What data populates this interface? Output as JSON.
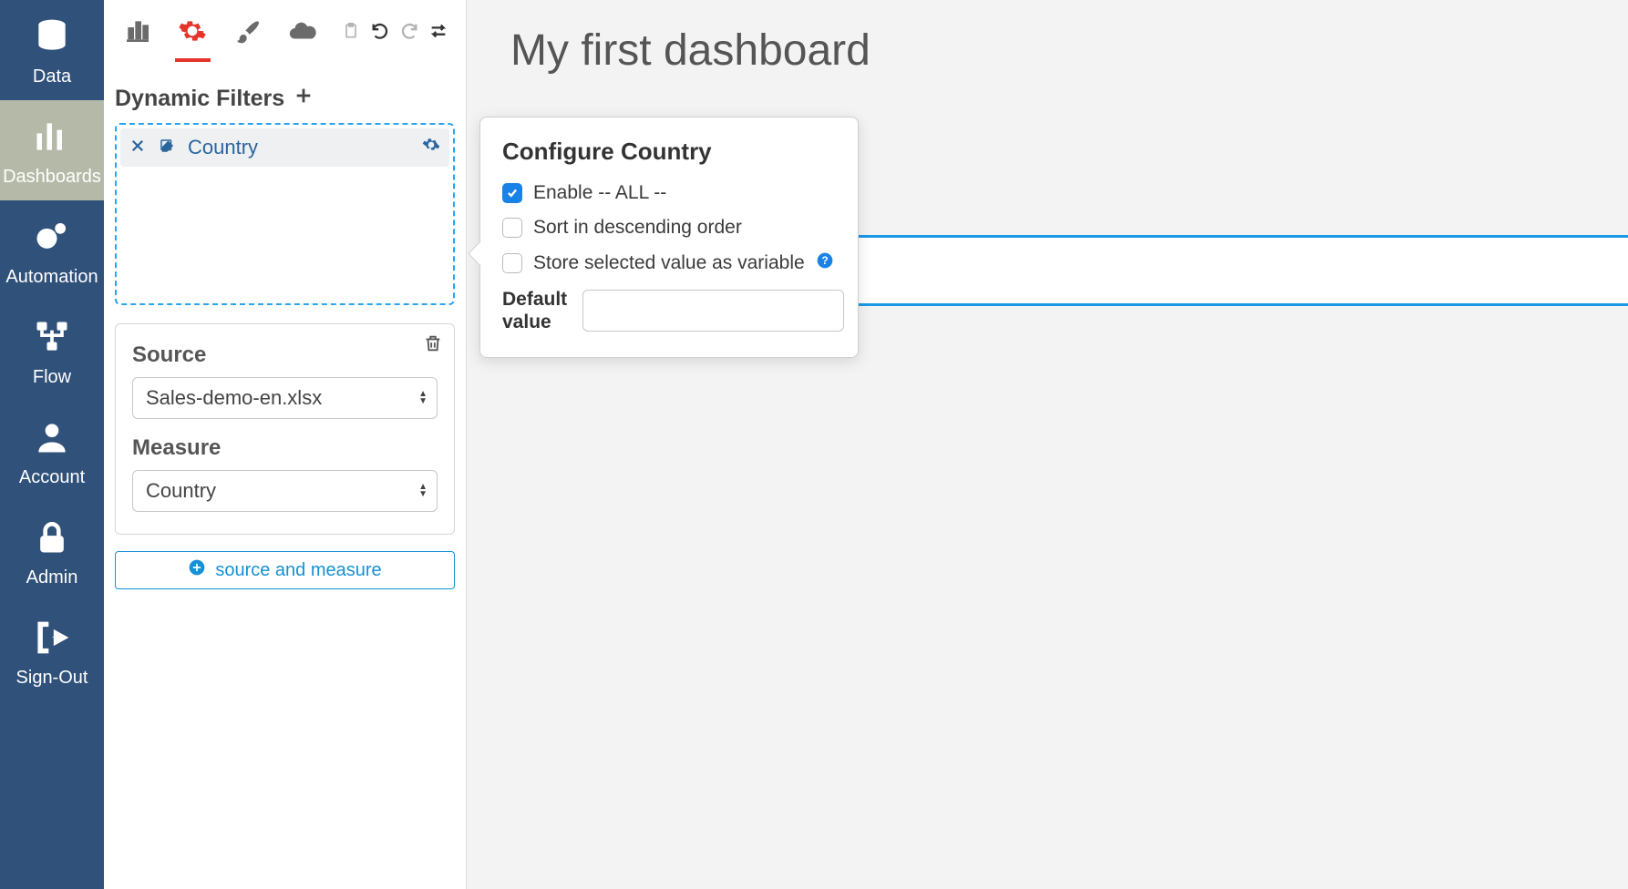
{
  "nav": {
    "items": [
      {
        "label": "Data"
      },
      {
        "label": "Dashboards"
      },
      {
        "label": "Automation"
      },
      {
        "label": "Flow"
      },
      {
        "label": "Account"
      },
      {
        "label": "Admin"
      },
      {
        "label": "Sign-Out"
      }
    ]
  },
  "panel": {
    "filters_title": "Dynamic Filters",
    "filter_chip": {
      "name": "Country"
    },
    "source_label": "Source",
    "source_value": "Sales-demo-en.xlsx",
    "measure_label": "Measure",
    "measure_value": "Country",
    "add_source_measure": "source and measure"
  },
  "canvas": {
    "title": "My first dashboard"
  },
  "popover": {
    "title": "Configure Country",
    "enable_all": "Enable -- ALL --",
    "sort_desc": "Sort in descending order",
    "store_var": "Store selected value as variable",
    "default_value_label": "Default value",
    "default_value": ""
  }
}
